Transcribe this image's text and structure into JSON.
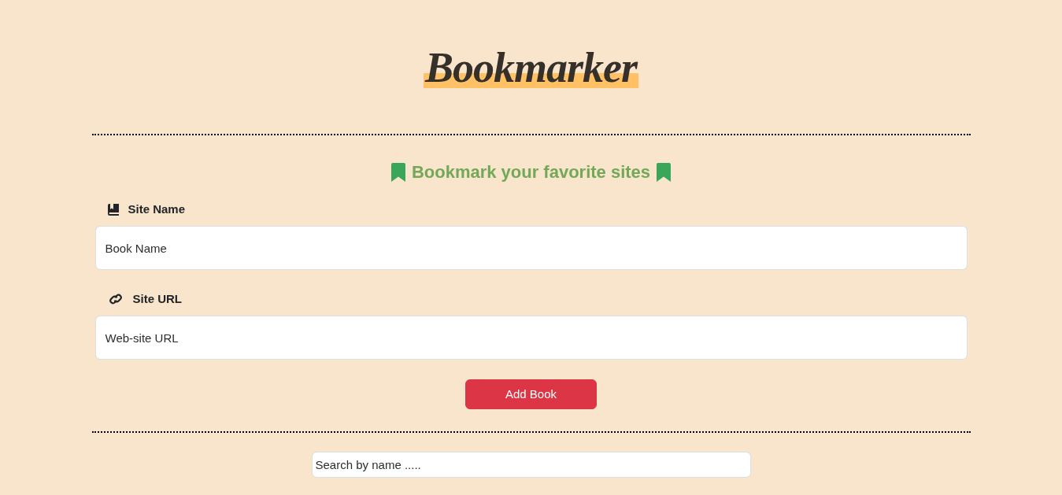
{
  "header": {
    "title": "Bookmarker"
  },
  "form": {
    "heading": "Bookmark your favorite sites",
    "fields": [
      {
        "kind": "book",
        "label": "Site Name",
        "placeholder": "Book Name"
      },
      {
        "kind": "link",
        "label": "Site URL",
        "placeholder": "Web-site URL"
      }
    ],
    "submit_button": "Add Book"
  },
  "search": {
    "placeholder": "Search by name ....."
  }
}
